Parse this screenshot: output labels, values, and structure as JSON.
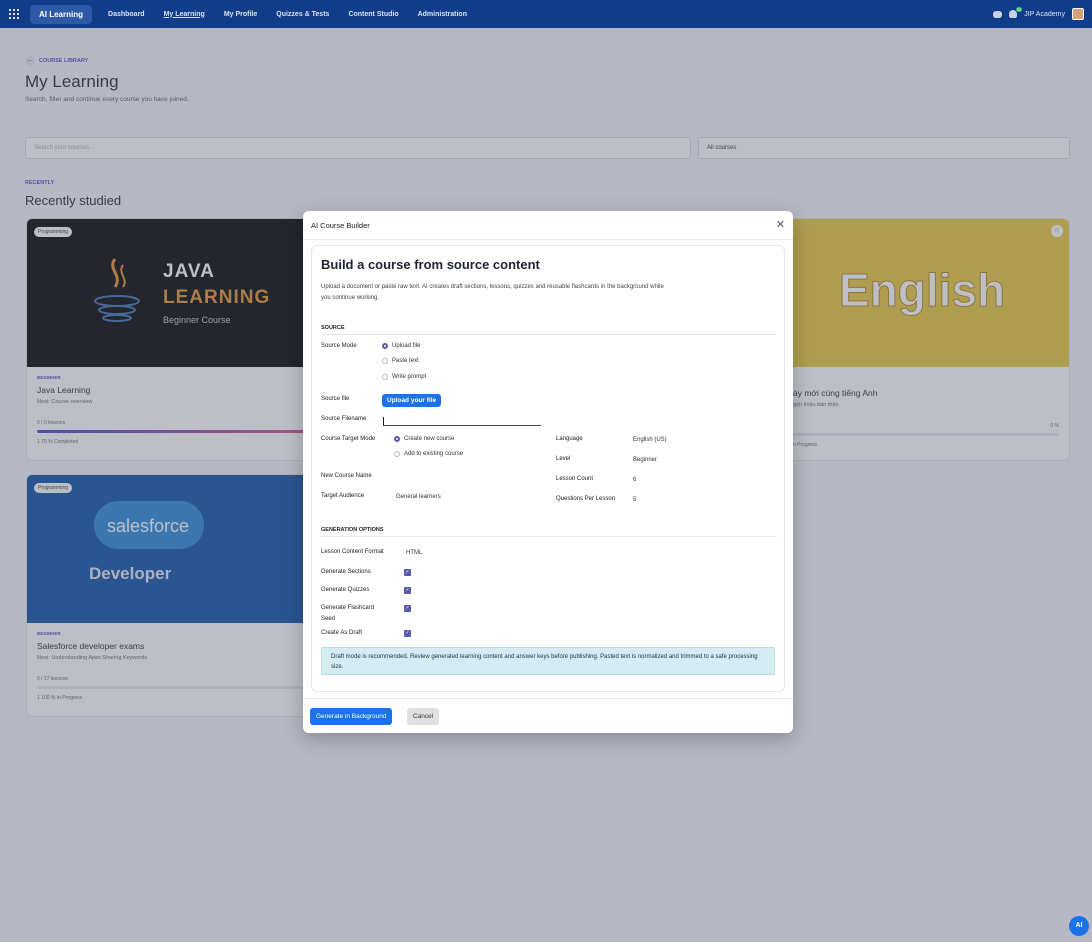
{
  "nav": {
    "brand": "AI Learning",
    "links": [
      "Dashboard",
      "My Learning",
      "My Profile",
      "Quizzes & Tests",
      "Content Studio",
      "Administration"
    ],
    "company": "JIP Academy",
    "notif_count": "22"
  },
  "page": {
    "back_label": "COURSE LIBRARY",
    "title": "My Learning",
    "subtitle": "Search, filter and continue every course you have joined.",
    "search_placeholder": "Search your courses...",
    "filter_value": "All courses",
    "recent_kicker": "RECENTLY",
    "recent_title": "Recently studied"
  },
  "cards": [
    {
      "tag": "Programming",
      "image_title": "JAVA",
      "image_title2": "LEARNING",
      "image_sub": "Beginner Course",
      "level": "BEGINNER",
      "name": "Java Learning",
      "next": "Next: Course overview",
      "lessons": "0 / 0 lessons",
      "progress": 1.0,
      "stats": "1   75 %   Completed"
    },
    {
      "tag": "Programming",
      "image_title": "salesforce",
      "image_title2": "Developer",
      "level": "BEGINNER",
      "name": "Salesforce developer exams",
      "next": "Next: Understanding Apex Sharing Keywords",
      "lessons": "0 / 17 lessons",
      "progress": 0.0,
      "stats": "1   100 %   In Progress"
    },
    {
      "image_title": "English",
      "name": "ày mới cùng tiếng Anh",
      "next": "giới thiệu bản thân",
      "percent": "0 %",
      "progress": 0.0,
      "stats": "n Progress"
    }
  ],
  "modal": {
    "title": "AI Course Builder",
    "heading": "Build a course from source content",
    "description": "Upload a document or paste raw text. AI creates draft sections, lessons, quizzes and reusable flashcards in the background while you continue working.",
    "source_section": "SOURCE",
    "source_mode_label": "Source Mode",
    "source_modes": [
      "Upload file",
      "Paste text",
      "Write prompt"
    ],
    "source_file_label": "Source file",
    "upload_button": "Upload your file",
    "source_filename_label": "Source Filename",
    "target_mode_label": "Course Target Mode",
    "target_modes": [
      "Create new course",
      "Add to existing course"
    ],
    "new_course_name_label": "New Course Name",
    "target_audience_label": "Target Audience",
    "target_audience_value": "General learners",
    "language_label": "Language",
    "language_value": "English (US)",
    "level_label": "Level",
    "level_value": "Beginner",
    "lesson_count_label": "Lesson Count",
    "lesson_count_value": "6",
    "questions_label": "Questions Per Lesson",
    "questions_value": "5",
    "gen_section": "GENERATION OPTIONS",
    "format_label": "Lesson Content Format",
    "format_value": "HTML",
    "gen_sections_label": "Generate Sections",
    "gen_quizzes_label": "Generate Quizzes",
    "gen_flashcard_label": "Generate Flashcard",
    "gen_flashcard_label2": "Seed",
    "draft_label": "Create As Draft",
    "info": "Draft mode is recommended. Review generated learning content and answer keys before publishing. Pasted text is normalized and trimmed to a safe processing size.",
    "generate_button": "Generate in Background",
    "cancel_button": "Cancel"
  },
  "fab": "AI"
}
